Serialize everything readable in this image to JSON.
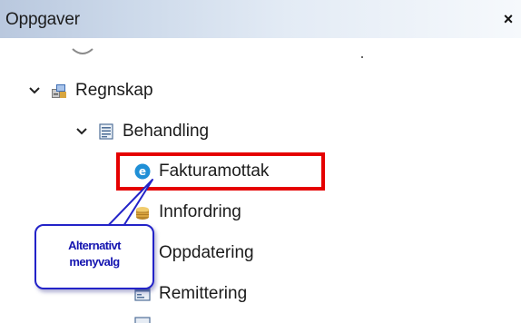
{
  "panel": {
    "title": "Oppgaver",
    "close_label": "×"
  },
  "tree": {
    "items": [
      {
        "label": "Regnskap",
        "icon": "accounting-icon",
        "expanded": true
      },
      {
        "label": "Behandling",
        "icon": "document-list-icon",
        "expanded": true
      },
      {
        "label": "Fakturamottak",
        "icon": "e-circle-icon",
        "highlighted": true
      },
      {
        "label": "Innfordring",
        "icon": "coins-icon"
      },
      {
        "label": "Oppdatering",
        "icon": "update-icon"
      },
      {
        "label": "Remittering",
        "icon": "remittance-icon"
      }
    ]
  },
  "callout": {
    "line1": "Alternativt",
    "line2": "menyvalg"
  },
  "colors": {
    "highlight": "#e50000",
    "callout_border": "#2323c8",
    "callout_text": "#1515b0",
    "e_icon": "#1f8fd6"
  }
}
